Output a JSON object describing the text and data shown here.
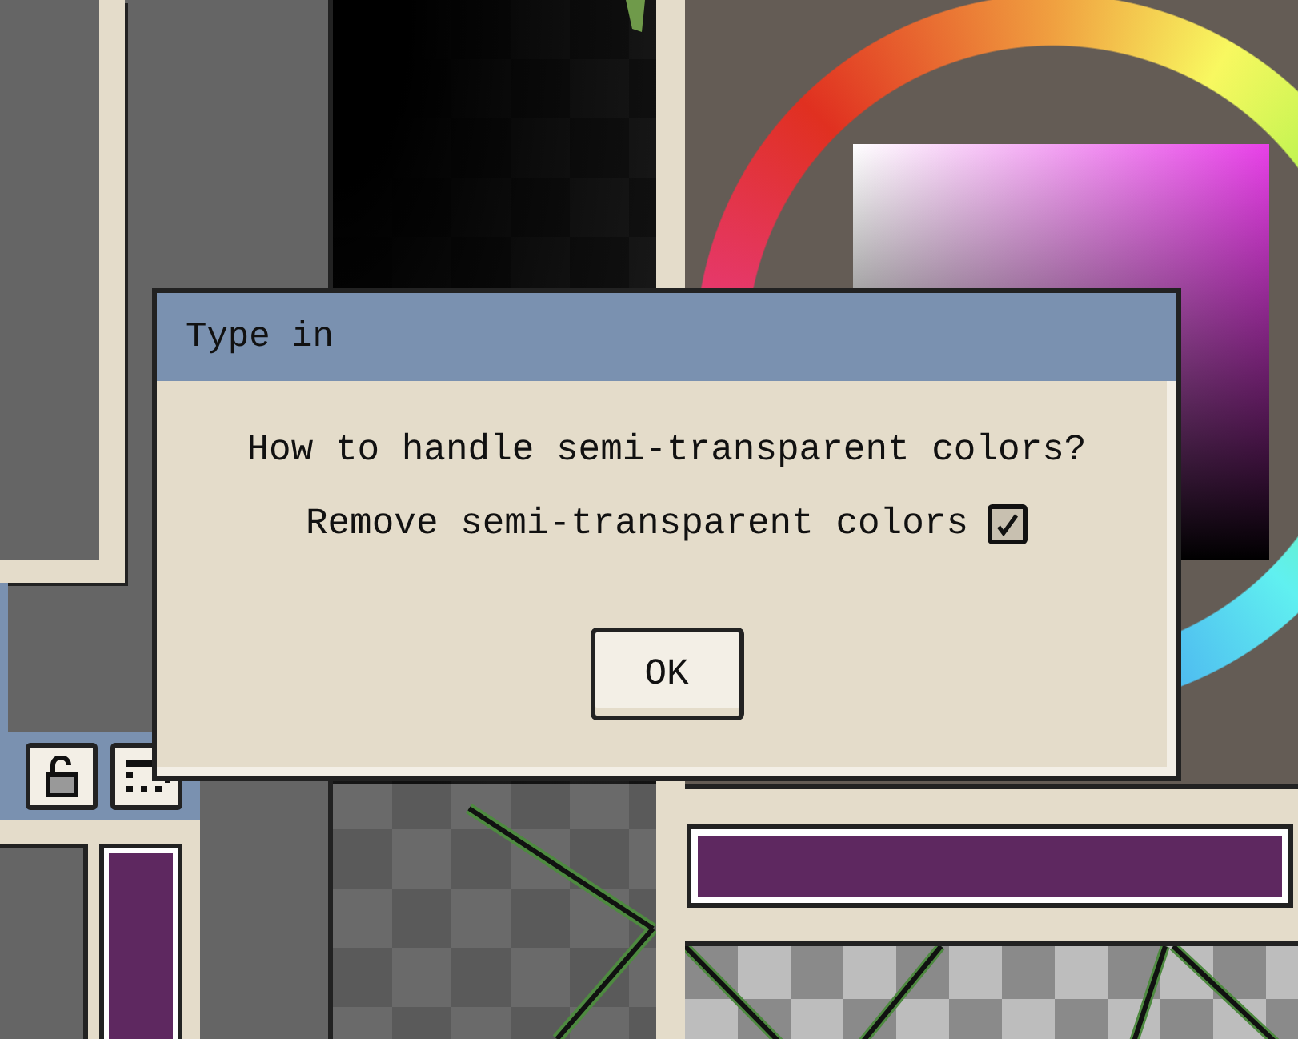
{
  "dialog": {
    "title": "Type in",
    "message": "How to handle semi-transparent colors?",
    "checkbox": {
      "label": "Remove semi-transparent colors",
      "checked": true
    },
    "buttons": [
      "OK"
    ]
  }
}
